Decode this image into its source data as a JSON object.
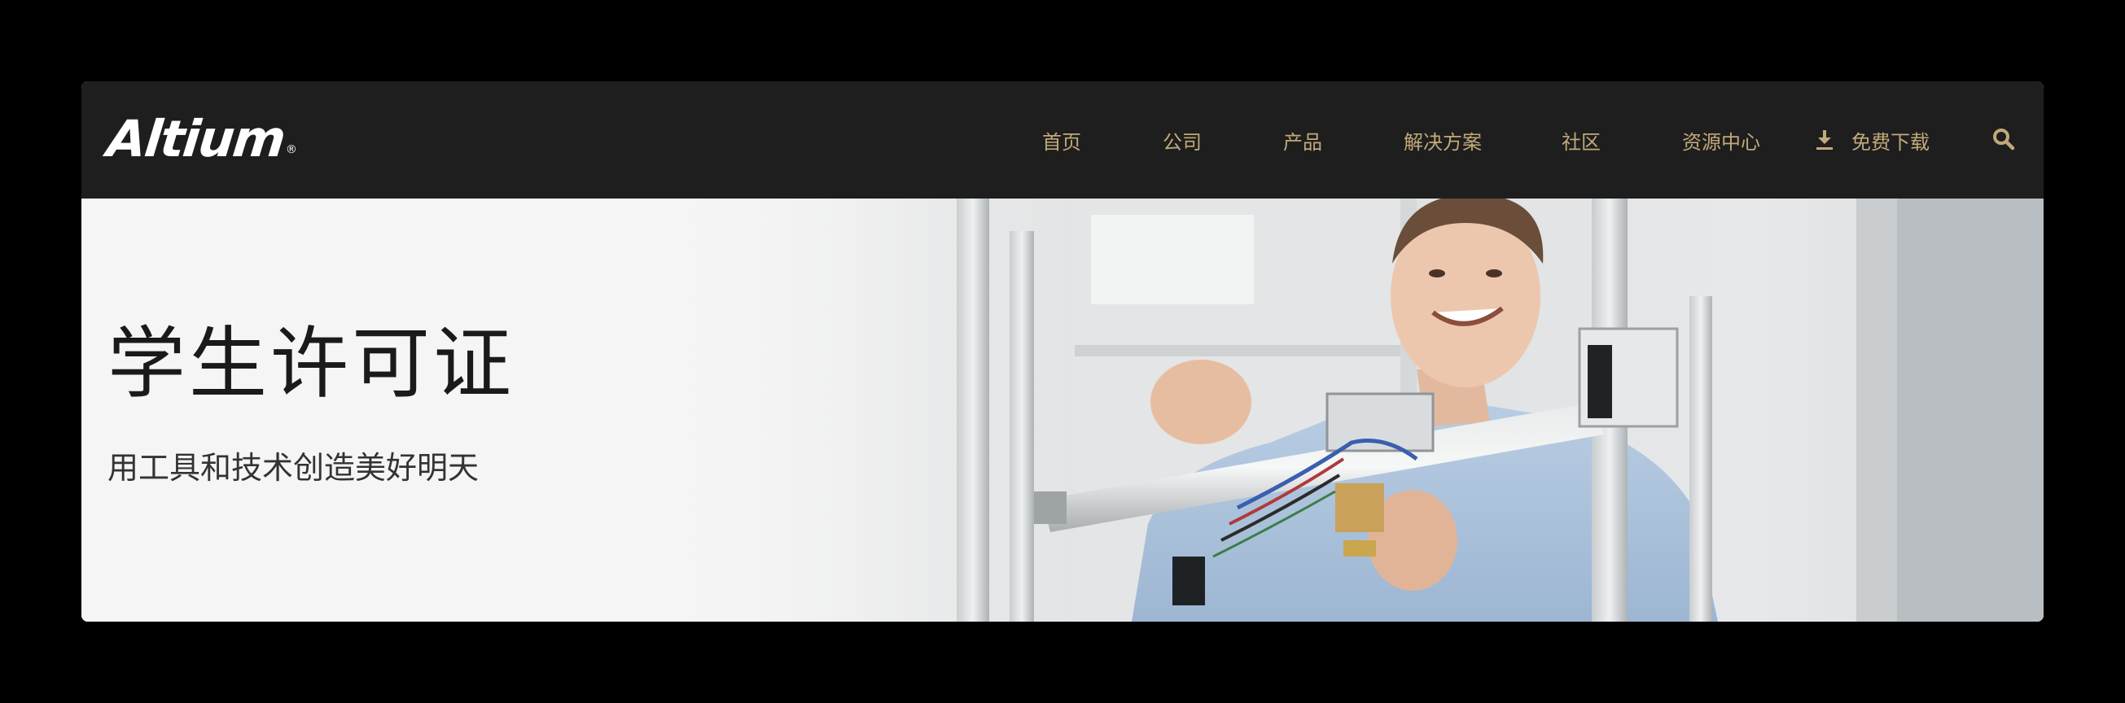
{
  "brand": {
    "logo_text": "Altium",
    "logo_mark": "®"
  },
  "nav": {
    "items": [
      {
        "label": "首页"
      },
      {
        "label": "公司"
      },
      {
        "label": "产品"
      },
      {
        "label": "解决方案"
      },
      {
        "label": "社区"
      },
      {
        "label": "资源中心"
      }
    ],
    "download": {
      "label": "免费下载",
      "icon": "download-icon"
    },
    "search": {
      "icon": "search-icon"
    }
  },
  "hero": {
    "title": "学生许可证",
    "subtitle": "用工具和技术创造美好明天",
    "image_description_icon": "hero-photo"
  },
  "colors": {
    "nav_background": "#1e1e1e",
    "nav_text": "#c2a97a",
    "hero_background": "#f5f5f5",
    "title_text": "#1a1a1a",
    "subtitle_text": "#333333",
    "page_background": "#000000"
  }
}
